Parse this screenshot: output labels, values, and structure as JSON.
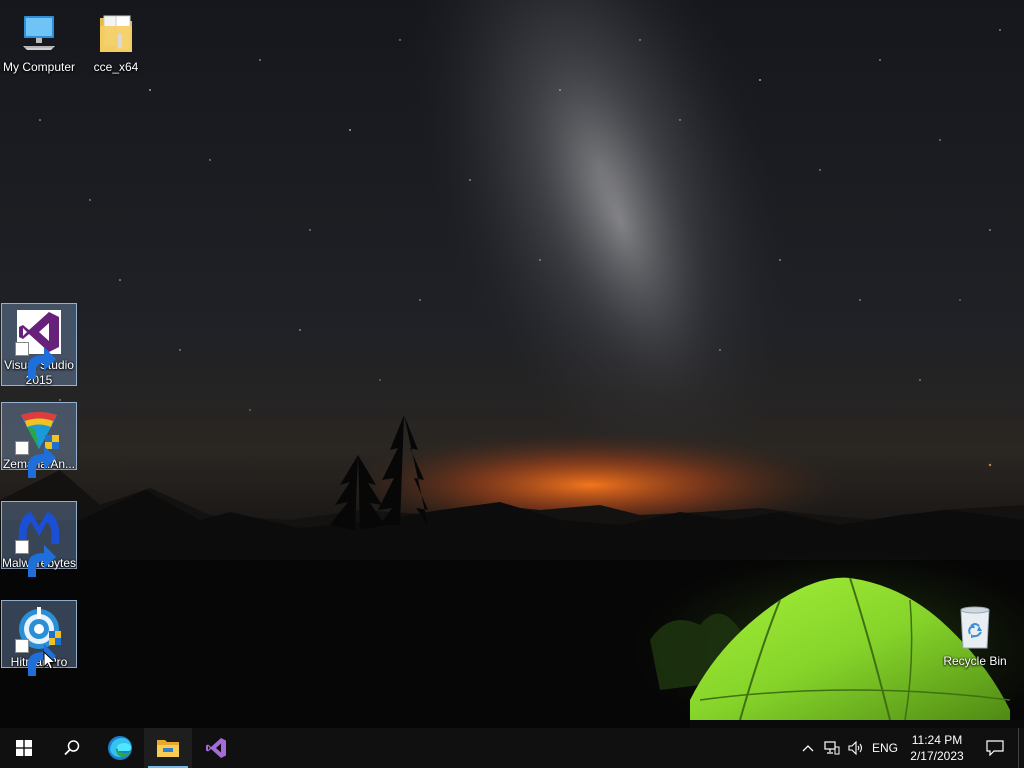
{
  "desktop": {
    "icons": [
      {
        "label": "My Computer",
        "icon": "computer-icon"
      },
      {
        "label": "cce_x64",
        "icon": "folder-icon"
      },
      {
        "label": "Visual Studio 2015",
        "icon": "visual-studio-icon",
        "selected": true
      },
      {
        "label": "Zemana.An...",
        "icon": "zemana-icon",
        "selected": true
      },
      {
        "label": "Malwarebytes",
        "icon": "malwarebytes-icon",
        "selected": true
      },
      {
        "label": "HitmanPro",
        "icon": "hitmanpro-icon",
        "selected": true
      },
      {
        "label": "Recycle Bin",
        "icon": "recycle-bin-icon"
      }
    ]
  },
  "taskbar": {
    "buttons": [
      "start-icon",
      "search-icon",
      "edge-icon",
      "file-explorer-icon",
      "visual-studio-icon"
    ],
    "tray": {
      "icons": [
        "chevron-up-icon",
        "network-icon",
        "volume-icon"
      ],
      "language": "ENG",
      "time": "11:24 PM",
      "date": "2/17/2023",
      "notification_icon": "action-center-icon"
    }
  },
  "colors": {
    "taskbar": "#101010",
    "accent": "#76b9ed",
    "selection": "#7896be",
    "tent": "#8ee02a"
  }
}
